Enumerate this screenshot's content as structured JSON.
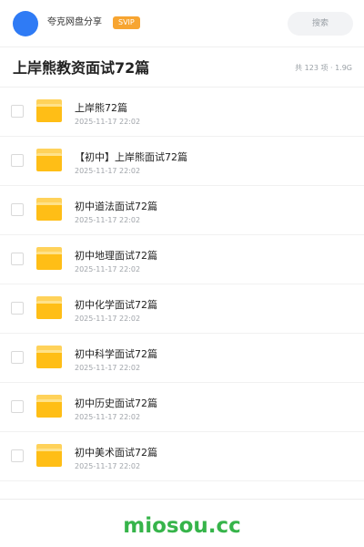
{
  "header": {
    "share_name": "夸克网盘分享",
    "badge": "SVIP",
    "search_placeholder": "搜索"
  },
  "folder": {
    "title": "上岸熊教资面试72篇",
    "meta": "共 123 项 · 1.9G"
  },
  "items": [
    {
      "name": "上岸熊72篇",
      "date": "2025-11-17 22:02"
    },
    {
      "name": "【初中】上岸熊面试72篇",
      "date": "2025-11-17 22:02"
    },
    {
      "name": "初中道法面试72篇",
      "date": "2025-11-17 22:02"
    },
    {
      "name": "初中地理面试72篇",
      "date": "2025-11-17 22:02"
    },
    {
      "name": "初中化学面试72篇",
      "date": "2025-11-17 22:02"
    },
    {
      "name": "初中科学面试72篇",
      "date": "2025-11-17 22:02"
    },
    {
      "name": "初中历史面试72篇",
      "date": "2025-11-17 22:02"
    },
    {
      "name": "初中美术面试72篇",
      "date": "2025-11-17 22:02"
    }
  ],
  "watermark": "miosou.cc",
  "colors": {
    "accent_blue": "#2f7bf5",
    "svip_orange": "#f7a531",
    "folder_yellow": "#ffbe16",
    "watermark_green": "#36b44a"
  },
  "icons": {
    "avatar": "avatar",
    "folder": "folder-icon",
    "checkbox": "checkbox"
  }
}
